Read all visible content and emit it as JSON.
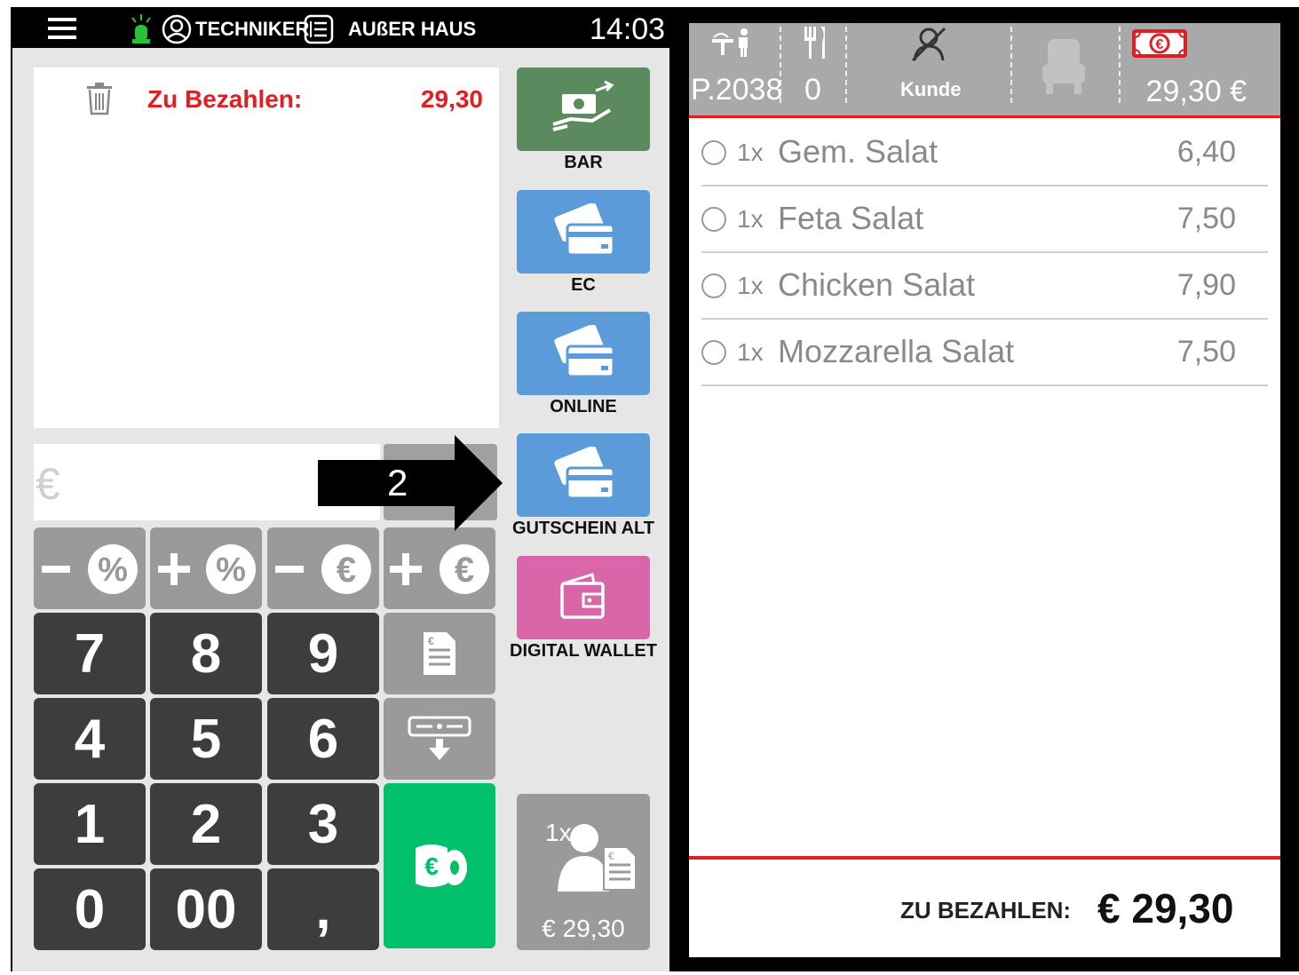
{
  "topbar": {
    "user": "TECHNIKER",
    "mode": "AUßER HAUS",
    "time": "14:03"
  },
  "receipt": {
    "label": "Zu Bezahlen:",
    "amount": "29,30"
  },
  "amount_input": {
    "currency": "€"
  },
  "adjust_keys": [
    "−%",
    "+%",
    "−€",
    "+€"
  ],
  "keypad": [
    "7",
    "8",
    "9",
    "4",
    "5",
    "6",
    "1",
    "2",
    "3",
    "0",
    "00",
    ","
  ],
  "payment_methods": [
    {
      "label": "BAR",
      "color": "#5a8a5e"
    },
    {
      "label": "EC",
      "color": "#5b9bd9"
    },
    {
      "label": "ONLINE",
      "color": "#5b9bd9"
    },
    {
      "label": "GUTSCHEIN ALT",
      "color": "#5b9bd9"
    },
    {
      "label": "DIGITAL WALLET",
      "color": "#d966a9"
    }
  ],
  "split_button": {
    "count": "1x",
    "amount": "€ 29,30"
  },
  "annotation": {
    "number": "2"
  },
  "order_header": {
    "table": "P.2038",
    "guests": "0",
    "customer": "Kunde",
    "total": "29,30 €"
  },
  "order_items": [
    {
      "qty": "1x",
      "name": "Gem. Salat",
      "price": "6,40"
    },
    {
      "qty": "1x",
      "name": "Feta Salat",
      "price": "7,50"
    },
    {
      "qty": "1x",
      "name": "Chicken Salat",
      "price": "7,90"
    },
    {
      "qty": "1x",
      "name": "Mozzarella Salat",
      "price": "7,50"
    }
  ],
  "footer": {
    "label": "ZU BEZAHLEN:",
    "amount": "€ 29,30"
  },
  "colors": {
    "accent_red": "#e11e22",
    "green": "#00c06a",
    "dark_key": "#3d3d3d"
  }
}
